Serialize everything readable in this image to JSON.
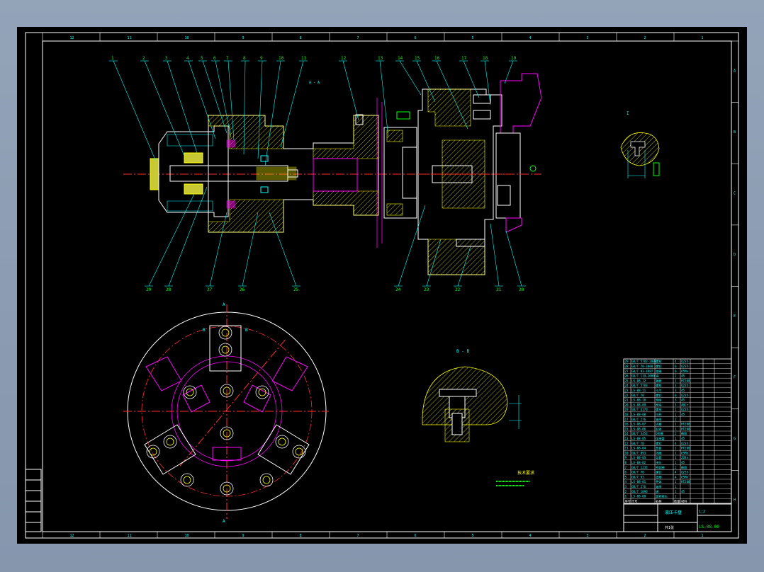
{
  "drawing": {
    "part_number": "LS-08-00",
    "view_label_a": "A - A",
    "view_label_b": "B - B",
    "view_label_detail": "I",
    "tech_note": "技术要求",
    "grid_letters": [
      "A",
      "B",
      "C",
      "D",
      "E",
      "F",
      "G",
      "H"
    ],
    "grid_numbers": [
      "12",
      "11",
      "10",
      "9",
      "8",
      "7",
      "6",
      "5",
      "4",
      "3",
      "2",
      "1"
    ],
    "balloons_top": [
      "1",
      "2",
      "3",
      "4",
      "5",
      "6",
      "7",
      "8",
      "9",
      "10",
      "11",
      "12",
      "13",
      "14",
      "15",
      "16",
      "17",
      "18",
      "19"
    ],
    "balloons_bottom": [
      "29",
      "28",
      "27",
      "26",
      "25",
      "24",
      "23",
      "22",
      "21",
      "20"
    ],
    "section_marks": [
      "A",
      "B",
      "B",
      "A"
    ]
  },
  "bom": {
    "rows": [
      {
        "no": "29",
        "code": "GB/T 5782-2000",
        "name": "螺栓",
        "qty": "4",
        "mat": "Q235"
      },
      {
        "no": "28",
        "code": "GB/T 70-2000",
        "name": "螺钉",
        "qty": "6",
        "mat": "Q235"
      },
      {
        "no": "27",
        "code": "GB/T 93-1987",
        "name": "垫圈",
        "qty": "6",
        "mat": "65Mn"
      },
      {
        "no": "26",
        "code": "GB/T 119-2000",
        "name": "销",
        "qty": "2",
        "mat": "45"
      },
      {
        "no": "25",
        "code": "LS-08-12",
        "name": "端盖",
        "qty": "1",
        "mat": "HT200"
      },
      {
        "no": "24",
        "code": "GB/T 5783",
        "name": "螺栓",
        "qty": "3",
        "mat": "Q235"
      },
      {
        "no": "23",
        "code": "LS-08-11",
        "name": "卡爪",
        "qty": "3",
        "mat": "45"
      },
      {
        "no": "22",
        "code": "GB/T 70",
        "name": "螺钉",
        "qty": "6",
        "mat": "Q235"
      },
      {
        "no": "21",
        "code": "LS-08-10",
        "name": "滑座",
        "qty": "3",
        "mat": "45"
      },
      {
        "no": "20",
        "code": "LS-08-09",
        "name": "楔块",
        "qty": "3",
        "mat": "40Cr"
      },
      {
        "no": "19",
        "code": "GB/T 6170",
        "name": "螺母",
        "qty": "1",
        "mat": "Q235"
      },
      {
        "no": "18",
        "code": "LS-08-08",
        "name": "拉杆",
        "qty": "1",
        "mat": "45"
      },
      {
        "no": "17",
        "code": "GB/T 276",
        "name": "轴承",
        "qty": "2",
        "mat": ""
      },
      {
        "no": "16",
        "code": "LS-08-07",
        "name": "活塞",
        "qty": "1",
        "mat": "HT200"
      },
      {
        "no": "15",
        "code": "LS-08-06",
        "name": "缸体",
        "qty": "1",
        "mat": "HT200"
      },
      {
        "no": "14",
        "code": "GB/T 3452",
        "name": "O形圈",
        "qty": "2",
        "mat": "橡胶"
      },
      {
        "no": "13",
        "code": "LS-08-05",
        "name": "连接盘",
        "qty": "1",
        "mat": "45"
      },
      {
        "no": "12",
        "code": "GB/T 70",
        "name": "螺钉",
        "qty": "4",
        "mat": "Q235"
      },
      {
        "no": "11",
        "code": "LS-08-04",
        "name": "盖板",
        "qty": "1",
        "mat": "HT200"
      },
      {
        "no": "10",
        "code": "GB/T 893",
        "name": "挡圈",
        "qty": "1",
        "mat": "65Mn"
      },
      {
        "no": "9",
        "code": "LS-08-03",
        "name": "导套",
        "qty": "1",
        "mat": "ZQSn"
      },
      {
        "no": "8",
        "code": "LS-08-02",
        "name": "接头",
        "qty": "1",
        "mat": "45"
      },
      {
        "no": "7",
        "code": "GB/T 1235",
        "name": "密封圈",
        "qty": "2",
        "mat": "橡胶"
      },
      {
        "no": "6",
        "code": "GB/T 70",
        "name": "螺钉",
        "qty": "4",
        "mat": "Q235"
      },
      {
        "no": "5",
        "code": "GB/T 93",
        "name": "垫圈",
        "qty": "4",
        "mat": "65Mn"
      },
      {
        "no": "4",
        "code": "LS-08-01",
        "name": "壳体",
        "qty": "1",
        "mat": "HT200"
      },
      {
        "no": "3",
        "code": "GB/T 276",
        "name": "轴承",
        "qty": "1",
        "mat": ""
      },
      {
        "no": "2",
        "code": "GB/T 1096",
        "name": "键",
        "qty": "1",
        "mat": "45"
      },
      {
        "no": "1",
        "code": "LS-08-00",
        "name": "旋转接头",
        "qty": "1",
        "mat": ""
      }
    ],
    "header": {
      "no": "序号",
      "code": "代号",
      "name": "名称",
      "qty": "数量",
      "mat": "材料"
    }
  },
  "title_block": {
    "title": "液压卡盘",
    "scale": "1:2",
    "drawing_no": "LS-08-00",
    "sheet": "共1张"
  }
}
